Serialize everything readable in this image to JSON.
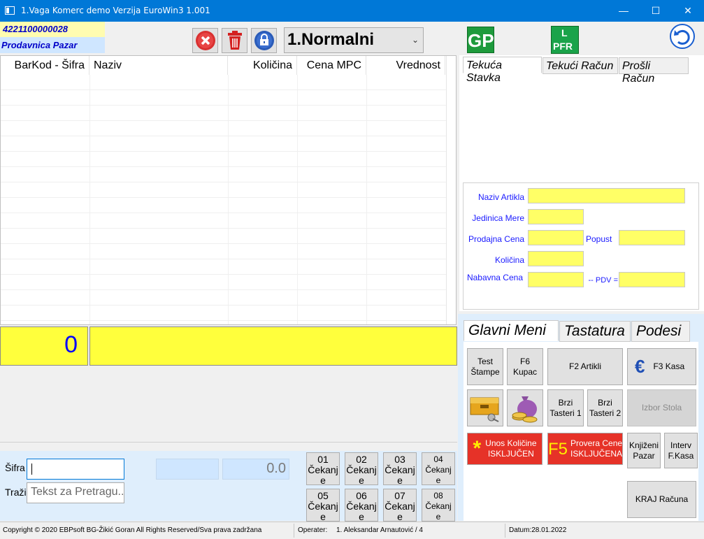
{
  "window": {
    "title": "1.Vaga Komerc demo Verzija EuroWin3 1.001",
    "minimize": "—",
    "maximize": "☐",
    "close": "✕"
  },
  "info": {
    "barcode": "4221100000028",
    "store": "Prodavnica Pazar"
  },
  "toolbar": {
    "mode": "1.Normalni",
    "gp_label": "GP",
    "pfr_top": "L",
    "pfr_bottom": "PFR"
  },
  "grid": {
    "columns": [
      "BarKod - Šifra",
      "Naziv",
      "Količina",
      "Cena MPC",
      "Vrednost"
    ]
  },
  "totals": {
    "amount": "0"
  },
  "entry": {
    "sifra_label": "Šifra",
    "trazi_label": "Traži",
    "trazi_placeholder": "Tekst za Pretragu...",
    "value": "0.0"
  },
  "cekanje": [
    {
      "num": "01",
      "label": "Čekanj",
      "tail": "e"
    },
    {
      "num": "02",
      "label": "Čekanj",
      "tail": "e"
    },
    {
      "num": "03",
      "label": "Čekanj",
      "tail": "e"
    },
    {
      "num": "04",
      "label": "Čekanj",
      "tail": "e"
    },
    {
      "num": "05",
      "label": "Čekanj",
      "tail": "e"
    },
    {
      "num": "06",
      "label": "Čekanj",
      "tail": "e"
    },
    {
      "num": "07",
      "label": "Čekanj",
      "tail": "e"
    },
    {
      "num": "08",
      "label": "Čekanj",
      "tail": "e"
    }
  ],
  "right_tabs": [
    "Tekuća Stavka",
    "Tekući Račun",
    "Prošli Račun"
  ],
  "item_fields": {
    "naziv": "Naziv Artikla",
    "jedinica": "Jedinica Mere",
    "prodajna": "Prodajna Cena",
    "popust": "Popust",
    "kolicina": "Količina",
    "nabavna": "Nabavna Cena",
    "pdv": "-- PDV ="
  },
  "menu_tabs": [
    "Glavni Meni",
    "Tastatura",
    "Podesi"
  ],
  "menu": {
    "test_stampe_1": "Test",
    "test_stampe_2": "Štampe",
    "f6_1": "F6",
    "f6_2": "Kupac",
    "f2": "F2 Artikli",
    "f3": "F3 Kasa",
    "brzi1_1": "Brzi",
    "brzi1_2": "Tasteri 1",
    "brzi2_1": "Brzi",
    "brzi2_2": "Tasteri 2",
    "izbor_stola": "Izbor Stola",
    "unos_1": "Unos Količine",
    "unos_2": "ISKLJUČEN",
    "f5_key": "F5",
    "f5_1": "Provera Cene",
    "f5_2": "ISKLJUČENA",
    "knjizeni_1": "Knjiženi",
    "knjizeni_2": "Pazar",
    "interv_1": "Interv",
    "interv_2": "F.Kasa",
    "kraj": "KRAJ Računa"
  },
  "status": {
    "copyright": "Copyright © 2020 EBPsoft BG-Žikić Goran All Rights Reserved/Sva prava zadržana",
    "operater_label": "Operater:",
    "operater": "1. Aleksandar Arnautović / 4",
    "datum": "Datum:28.01.2022"
  },
  "colors": {
    "titlebar": "#0078d7",
    "yellow_total": "#ffff3c",
    "field_yellow": "#ffff66",
    "red_button": "#e63228",
    "label_blue": "#1a1aff"
  }
}
